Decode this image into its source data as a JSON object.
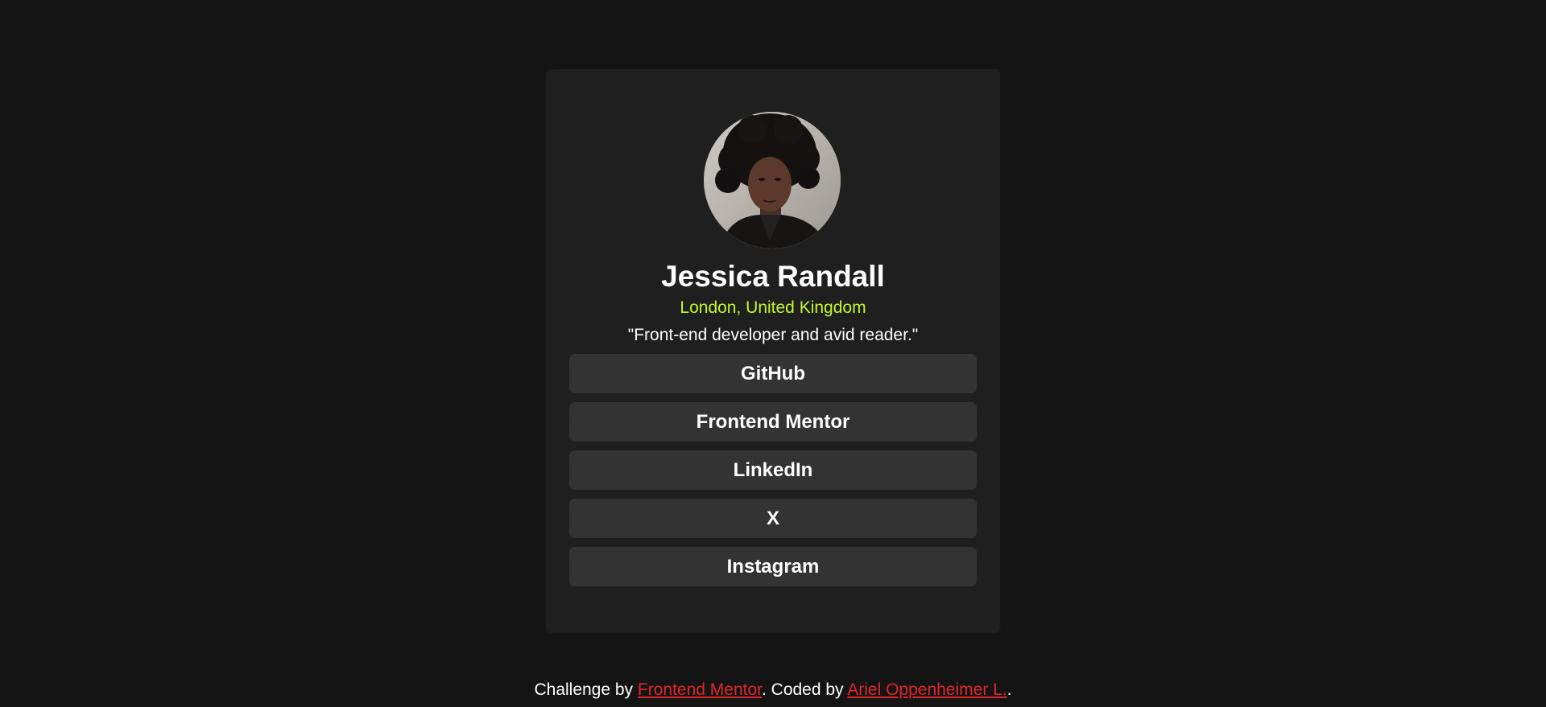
{
  "profile": {
    "name": "Jessica Randall",
    "location": "London, United Kingdom",
    "bio": "\"Front-end developer and avid reader.\""
  },
  "links": [
    {
      "label": "GitHub"
    },
    {
      "label": "Frontend Mentor"
    },
    {
      "label": "LinkedIn"
    },
    {
      "label": "X"
    },
    {
      "label": "Instagram"
    }
  ],
  "footer": {
    "prefix": "Challenge by ",
    "challenge_link": "Frontend Mentor",
    "middle": ". Coded by ",
    "author_link": "Ariel Oppenheimer L.",
    "suffix": "."
  },
  "colors": {
    "page_background": "#141414",
    "card_background": "#1f1f1f",
    "button_background": "#333333",
    "accent_green": "#c4f82a",
    "link_red": "#e0252b",
    "text": "#ffffff"
  }
}
